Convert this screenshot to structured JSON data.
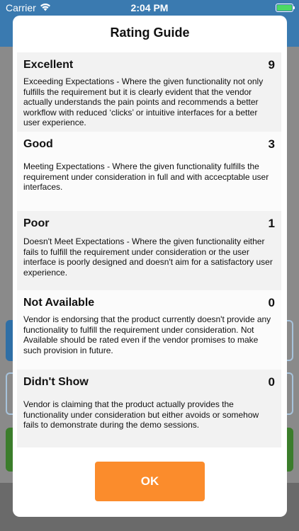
{
  "status_bar": {
    "carrier": "Carrier",
    "time": "2:04 PM",
    "battery_color": "#4cd964",
    "wifi_icon": "wifi-icon",
    "battery_icon": "battery-icon"
  },
  "modal": {
    "title": "Rating Guide",
    "ok_label": "OK",
    "ok_color": "#fb8c2c",
    "ratings": [
      {
        "name": "Excellent",
        "score": "9",
        "description": "Exceeding Expectations - Where the given functionality not only fulfills the requirement but it is clearly evident that the vendor actually understands the pain points and recommends a better workflow with reduced ‘clicks’ or intuitive interfaces for a better user experience."
      },
      {
        "name": "Good",
        "score": "3",
        "description": "Meeting Expectations - Where the given functionality fulfills the requirement under consideration in full and with accecptable user interfaces."
      },
      {
        "name": "Poor",
        "score": "1",
        "description": "Doesn't Meet Expectations - Where the given functionality either fails to fulfill the requirement under consideration or the user interface is poorly designed and doesn't aim for a satisfactory user experience."
      },
      {
        "name": "Not Available",
        "score": "0",
        "description": "Vendor is endorsing that the product currently doesn't provide any functionality to fulfill the requirement under consideration. Not Available should be rated even if the vendor promises to make such provision in future."
      },
      {
        "name": "Didn't Show",
        "score": "0",
        "description": "Vendor is claiming that the product actually provides the functionality under consideration but either avoids or somehow fails to demonstrate during the demo sessions."
      }
    ]
  }
}
